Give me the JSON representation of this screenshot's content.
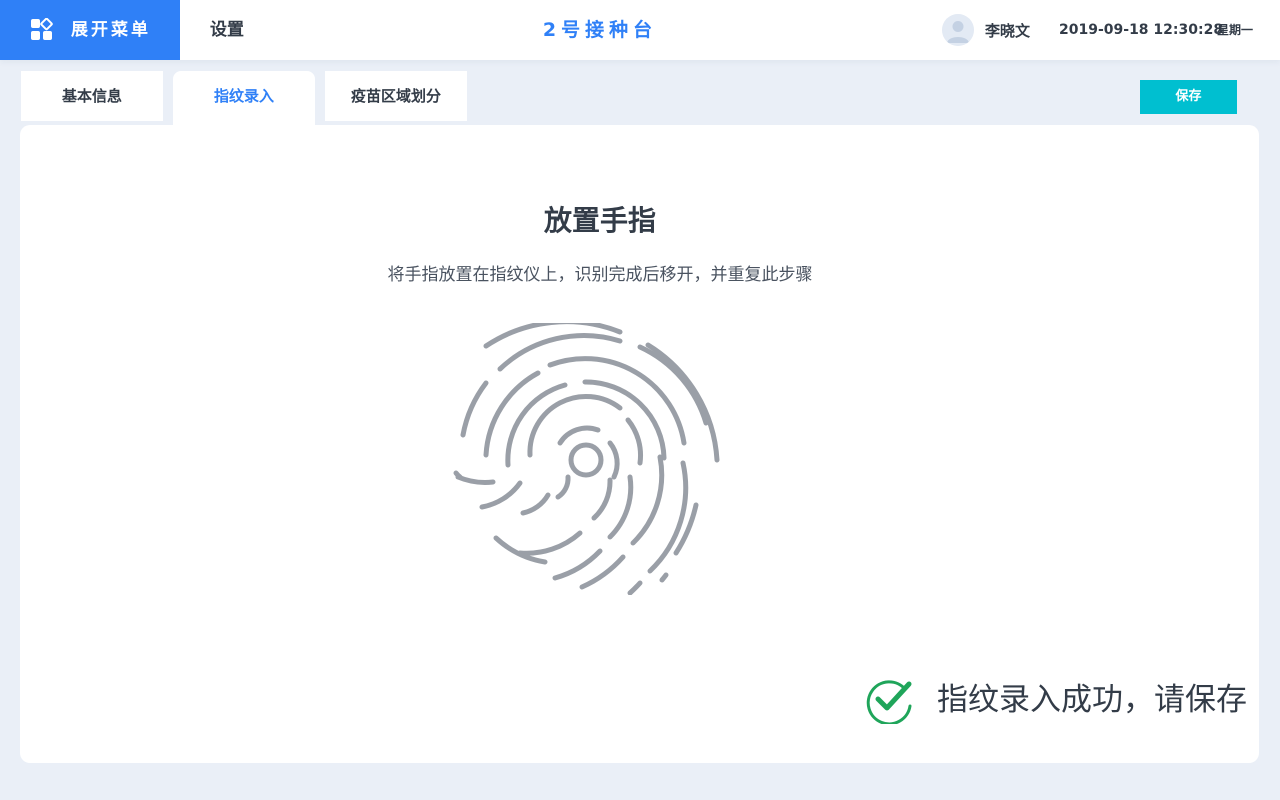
{
  "header": {
    "menu_label": "展开菜单",
    "page_title": "设置",
    "station": "2号接种台",
    "user_name": "李晓文",
    "datetime": "2019-09-18 12:30:28",
    "weekday": "星期一"
  },
  "tabs": [
    {
      "label": "基本信息",
      "active": false
    },
    {
      "label": "指纹录入",
      "active": true
    },
    {
      "label": "疫苗区域划分",
      "active": false
    }
  ],
  "toolbar": {
    "save_label": "保存"
  },
  "main": {
    "heading": "放置手指",
    "instruction": "将手指放置在指纹仪上，识别完成后移开，并重复此步骤",
    "success_message": "指纹录入成功，请保存"
  },
  "icons": {
    "menu": "grid-menu-icon",
    "avatar": "user-avatar",
    "fingerprint": "fingerprint-icon",
    "success": "check-circle-icon"
  },
  "colors": {
    "primary": "#2f80f7",
    "save": "#00bfd0",
    "background": "#eaeff7",
    "text": "#333c48",
    "fingerprint": "#9a9fa7",
    "success": "#1fa55a"
  }
}
